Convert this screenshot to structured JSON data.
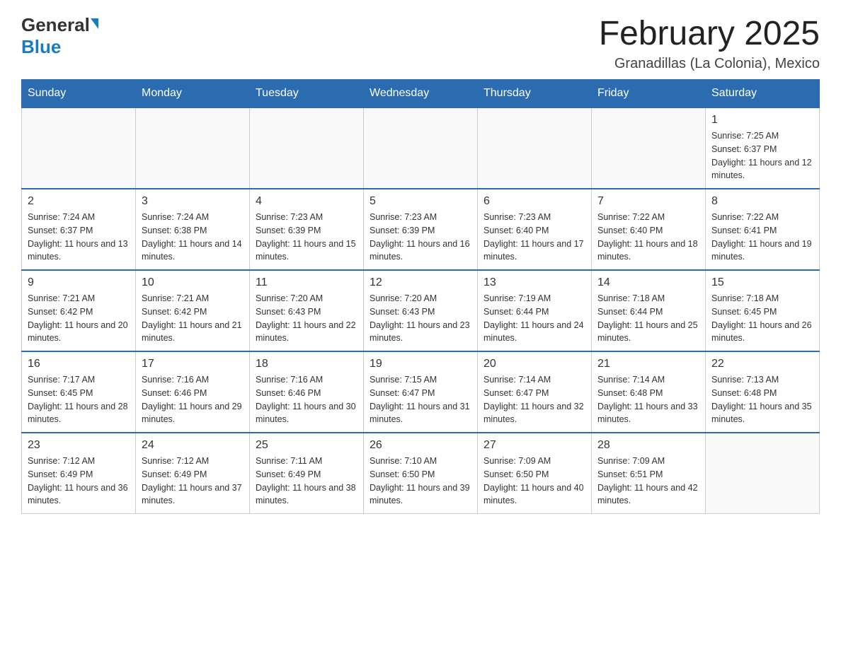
{
  "header": {
    "logo_general": "General",
    "logo_blue": "Blue",
    "month_title": "February 2025",
    "location": "Granadillas (La Colonia), Mexico"
  },
  "days_of_week": [
    "Sunday",
    "Monday",
    "Tuesday",
    "Wednesday",
    "Thursday",
    "Friday",
    "Saturday"
  ],
  "weeks": [
    [
      {
        "day": "",
        "info": ""
      },
      {
        "day": "",
        "info": ""
      },
      {
        "day": "",
        "info": ""
      },
      {
        "day": "",
        "info": ""
      },
      {
        "day": "",
        "info": ""
      },
      {
        "day": "",
        "info": ""
      },
      {
        "day": "1",
        "info": "Sunrise: 7:25 AM\nSunset: 6:37 PM\nDaylight: 11 hours and 12 minutes."
      }
    ],
    [
      {
        "day": "2",
        "info": "Sunrise: 7:24 AM\nSunset: 6:37 PM\nDaylight: 11 hours and 13 minutes."
      },
      {
        "day": "3",
        "info": "Sunrise: 7:24 AM\nSunset: 6:38 PM\nDaylight: 11 hours and 14 minutes."
      },
      {
        "day": "4",
        "info": "Sunrise: 7:23 AM\nSunset: 6:39 PM\nDaylight: 11 hours and 15 minutes."
      },
      {
        "day": "5",
        "info": "Sunrise: 7:23 AM\nSunset: 6:39 PM\nDaylight: 11 hours and 16 minutes."
      },
      {
        "day": "6",
        "info": "Sunrise: 7:23 AM\nSunset: 6:40 PM\nDaylight: 11 hours and 17 minutes."
      },
      {
        "day": "7",
        "info": "Sunrise: 7:22 AM\nSunset: 6:40 PM\nDaylight: 11 hours and 18 minutes."
      },
      {
        "day": "8",
        "info": "Sunrise: 7:22 AM\nSunset: 6:41 PM\nDaylight: 11 hours and 19 minutes."
      }
    ],
    [
      {
        "day": "9",
        "info": "Sunrise: 7:21 AM\nSunset: 6:42 PM\nDaylight: 11 hours and 20 minutes."
      },
      {
        "day": "10",
        "info": "Sunrise: 7:21 AM\nSunset: 6:42 PM\nDaylight: 11 hours and 21 minutes."
      },
      {
        "day": "11",
        "info": "Sunrise: 7:20 AM\nSunset: 6:43 PM\nDaylight: 11 hours and 22 minutes."
      },
      {
        "day": "12",
        "info": "Sunrise: 7:20 AM\nSunset: 6:43 PM\nDaylight: 11 hours and 23 minutes."
      },
      {
        "day": "13",
        "info": "Sunrise: 7:19 AM\nSunset: 6:44 PM\nDaylight: 11 hours and 24 minutes."
      },
      {
        "day": "14",
        "info": "Sunrise: 7:18 AM\nSunset: 6:44 PM\nDaylight: 11 hours and 25 minutes."
      },
      {
        "day": "15",
        "info": "Sunrise: 7:18 AM\nSunset: 6:45 PM\nDaylight: 11 hours and 26 minutes."
      }
    ],
    [
      {
        "day": "16",
        "info": "Sunrise: 7:17 AM\nSunset: 6:45 PM\nDaylight: 11 hours and 28 minutes."
      },
      {
        "day": "17",
        "info": "Sunrise: 7:16 AM\nSunset: 6:46 PM\nDaylight: 11 hours and 29 minutes."
      },
      {
        "day": "18",
        "info": "Sunrise: 7:16 AM\nSunset: 6:46 PM\nDaylight: 11 hours and 30 minutes."
      },
      {
        "day": "19",
        "info": "Sunrise: 7:15 AM\nSunset: 6:47 PM\nDaylight: 11 hours and 31 minutes."
      },
      {
        "day": "20",
        "info": "Sunrise: 7:14 AM\nSunset: 6:47 PM\nDaylight: 11 hours and 32 minutes."
      },
      {
        "day": "21",
        "info": "Sunrise: 7:14 AM\nSunset: 6:48 PM\nDaylight: 11 hours and 33 minutes."
      },
      {
        "day": "22",
        "info": "Sunrise: 7:13 AM\nSunset: 6:48 PM\nDaylight: 11 hours and 35 minutes."
      }
    ],
    [
      {
        "day": "23",
        "info": "Sunrise: 7:12 AM\nSunset: 6:49 PM\nDaylight: 11 hours and 36 minutes."
      },
      {
        "day": "24",
        "info": "Sunrise: 7:12 AM\nSunset: 6:49 PM\nDaylight: 11 hours and 37 minutes."
      },
      {
        "day": "25",
        "info": "Sunrise: 7:11 AM\nSunset: 6:49 PM\nDaylight: 11 hours and 38 minutes."
      },
      {
        "day": "26",
        "info": "Sunrise: 7:10 AM\nSunset: 6:50 PM\nDaylight: 11 hours and 39 minutes."
      },
      {
        "day": "27",
        "info": "Sunrise: 7:09 AM\nSunset: 6:50 PM\nDaylight: 11 hours and 40 minutes."
      },
      {
        "day": "28",
        "info": "Sunrise: 7:09 AM\nSunset: 6:51 PM\nDaylight: 11 hours and 42 minutes."
      },
      {
        "day": "",
        "info": ""
      }
    ]
  ]
}
